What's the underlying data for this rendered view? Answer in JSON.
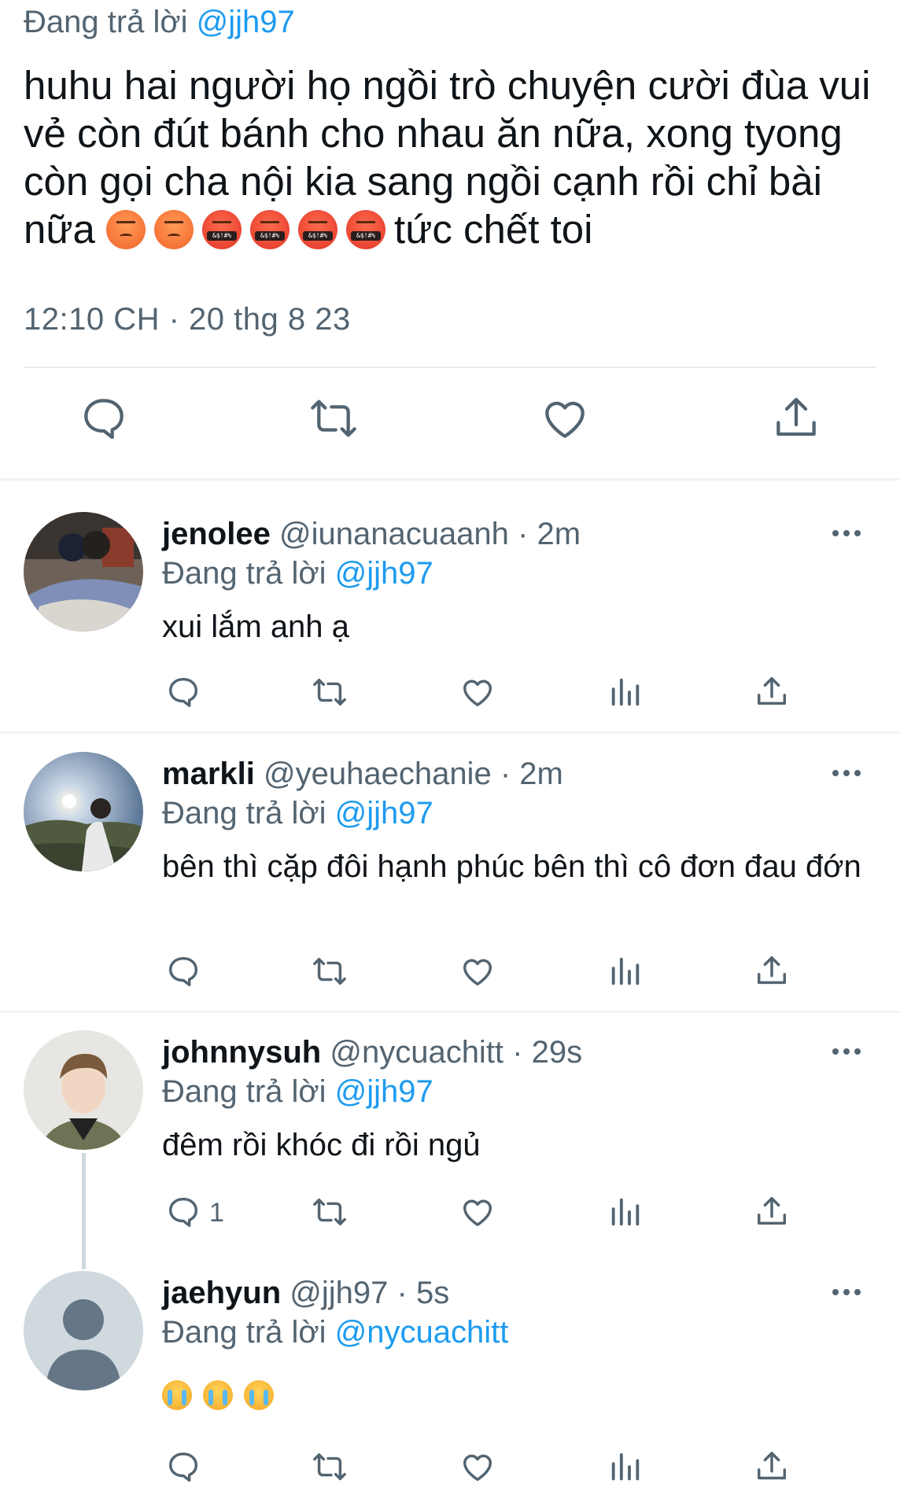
{
  "main_tweet": {
    "replying_label": "Đang trả lời",
    "replying_handle": "@jjh97",
    "text": "huhu hai người họ ngồi trò chuyện cười đùa vui vẻ còn đút bánh cho nhau ăn nữa, xong tyong còn gọi cha nội kia sang ngồi cạnh rồi chỉ bài nữa",
    "text_tail": "tức chết toi",
    "emojis": [
      "angry-face",
      "angry-face",
      "face-with-symbols-on-mouth",
      "face-with-symbols-on-mouth",
      "face-with-symbols-on-mouth",
      "face-with-symbols-on-mouth"
    ],
    "curse_symbols": "&$!#%",
    "meta": "12:10 CH · 20 thg 8 23",
    "actions": [
      "reply-icon",
      "retweet-icon",
      "like-icon",
      "share-icon"
    ]
  },
  "replies": [
    {
      "name": "jenolee",
      "handle": "@iunanacuaanh",
      "time": "· 2m",
      "replying_label": "Đang trả lời",
      "replying_handle": "@jjh97",
      "text": "xui lắm anh ạ",
      "reply_count": ""
    },
    {
      "name": "markli",
      "handle": "@yeuhaechanie",
      "time": "· 2m",
      "replying_label": "Đang trả lời",
      "replying_handle": "@jjh97",
      "text": "bên thì cặp đôi hạnh phúc bên thì cô đơn đau đớn",
      "reply_count": ""
    },
    {
      "name": "johnnysuh",
      "handle": "@nycuachitt",
      "time": "· 29s",
      "replying_label": "Đang trả lời",
      "replying_handle": "@jjh97",
      "text": "đêm rồi khóc đi rồi ngủ",
      "reply_count": "1"
    },
    {
      "name": "jaehyun",
      "handle": "@jjh97",
      "time": "· 5s",
      "replying_label": "Đang trả lời",
      "replying_handle": "@nycuachitt",
      "text": "",
      "emojis": [
        "loudly-crying-face",
        "loudly-crying-face",
        "loudly-crying-face"
      ],
      "reply_count": ""
    }
  ],
  "colors": {
    "link": "#1d9bf0",
    "muted": "#536471",
    "divider": "#eff3f4"
  }
}
